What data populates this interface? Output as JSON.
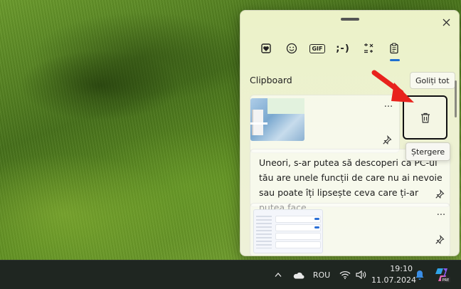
{
  "panel": {
    "tabs": [
      {
        "name": "Favorites",
        "icon": "heart-icon"
      },
      {
        "name": "Emoji",
        "icon": "smiley-icon"
      },
      {
        "name": "GIF",
        "icon": "gif-icon",
        "label": "GIF"
      },
      {
        "name": "Kaomoji",
        "icon": "kaomoji-icon",
        "label": ";-)"
      },
      {
        "name": "Symbols",
        "icon": "symbols-icon"
      },
      {
        "name": "Clipboard",
        "icon": "clipboard-icon",
        "active": true
      }
    ],
    "section_title": "Clipboard",
    "clear_all_label": "Goliți tot",
    "items": [
      {
        "type": "image"
      },
      {
        "type": "text",
        "text": "Uneori, s-ar putea să descoperi că PC-ul tău are unele funcții de care nu ai nevoie sau poate îți lipsește ceva care ți-ar putea face"
      },
      {
        "type": "image"
      }
    ],
    "more_symbol": "···",
    "delete_tooltip": "Ștergere"
  },
  "taskbar": {
    "language": "ROU",
    "time": "19:10",
    "date": "11.07.2024",
    "pre_badge": "PRE"
  },
  "colors": {
    "accent": "#1f6fd1",
    "arrow": "#e8221c",
    "taskbar": "#1f2621"
  }
}
